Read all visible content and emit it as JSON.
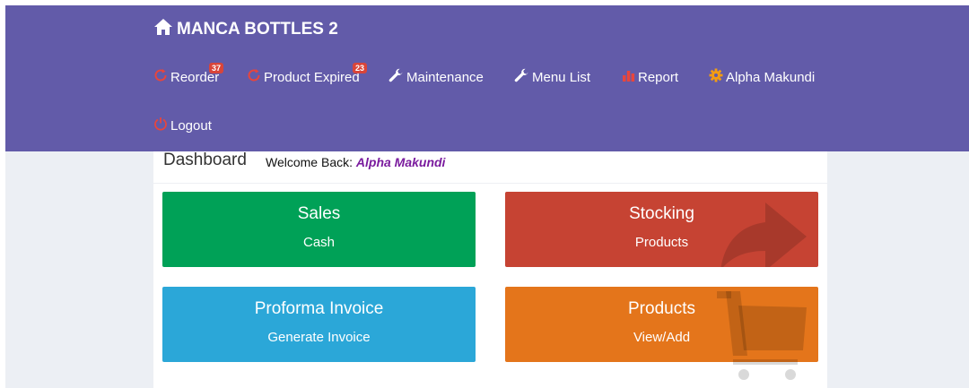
{
  "brand": {
    "title": "MANCA BOTTLES 2",
    "icon": "home-icon"
  },
  "nav": {
    "reorder": {
      "label": "Reorder",
      "badge": "37",
      "icon": "refresh-icon"
    },
    "expired": {
      "label": "Product Expired",
      "badge": "23",
      "icon": "refresh-icon"
    },
    "maintenance": {
      "label": "Maintenance",
      "icon": "wrench-icon"
    },
    "menu_list": {
      "label": "Menu List",
      "icon": "wrench-icon"
    },
    "report": {
      "label": "Report",
      "icon": "bar-chart-icon"
    },
    "user": {
      "label": "Alpha Makundi",
      "icon": "gear-icon"
    },
    "logout": {
      "label": "Logout",
      "icon": "power-icon"
    }
  },
  "dashboard": {
    "title": "Dashboard",
    "welcome_prefix": "Welcome Back:",
    "welcome_name": "Alpha Makundi"
  },
  "boxes": {
    "sales": {
      "title": "Sales",
      "sub": "Cash",
      "color": "#00a157"
    },
    "stocking": {
      "title": "Stocking",
      "sub": "Products",
      "color": "#c64333",
      "icon": "share-arrow-icon"
    },
    "proforma": {
      "title": "Proforma Invoice",
      "sub": "Generate Invoice",
      "color": "#2ba7d8"
    },
    "products": {
      "title": "Products",
      "sub": "View/Add",
      "color": "#e4751b",
      "icon": "shopping-cart-icon"
    }
  },
  "colors": {
    "navbar": "#625ba9",
    "badge": "#d9453a",
    "nav_icon_red": "#e8453c",
    "gear_orange": "#f39c12"
  }
}
